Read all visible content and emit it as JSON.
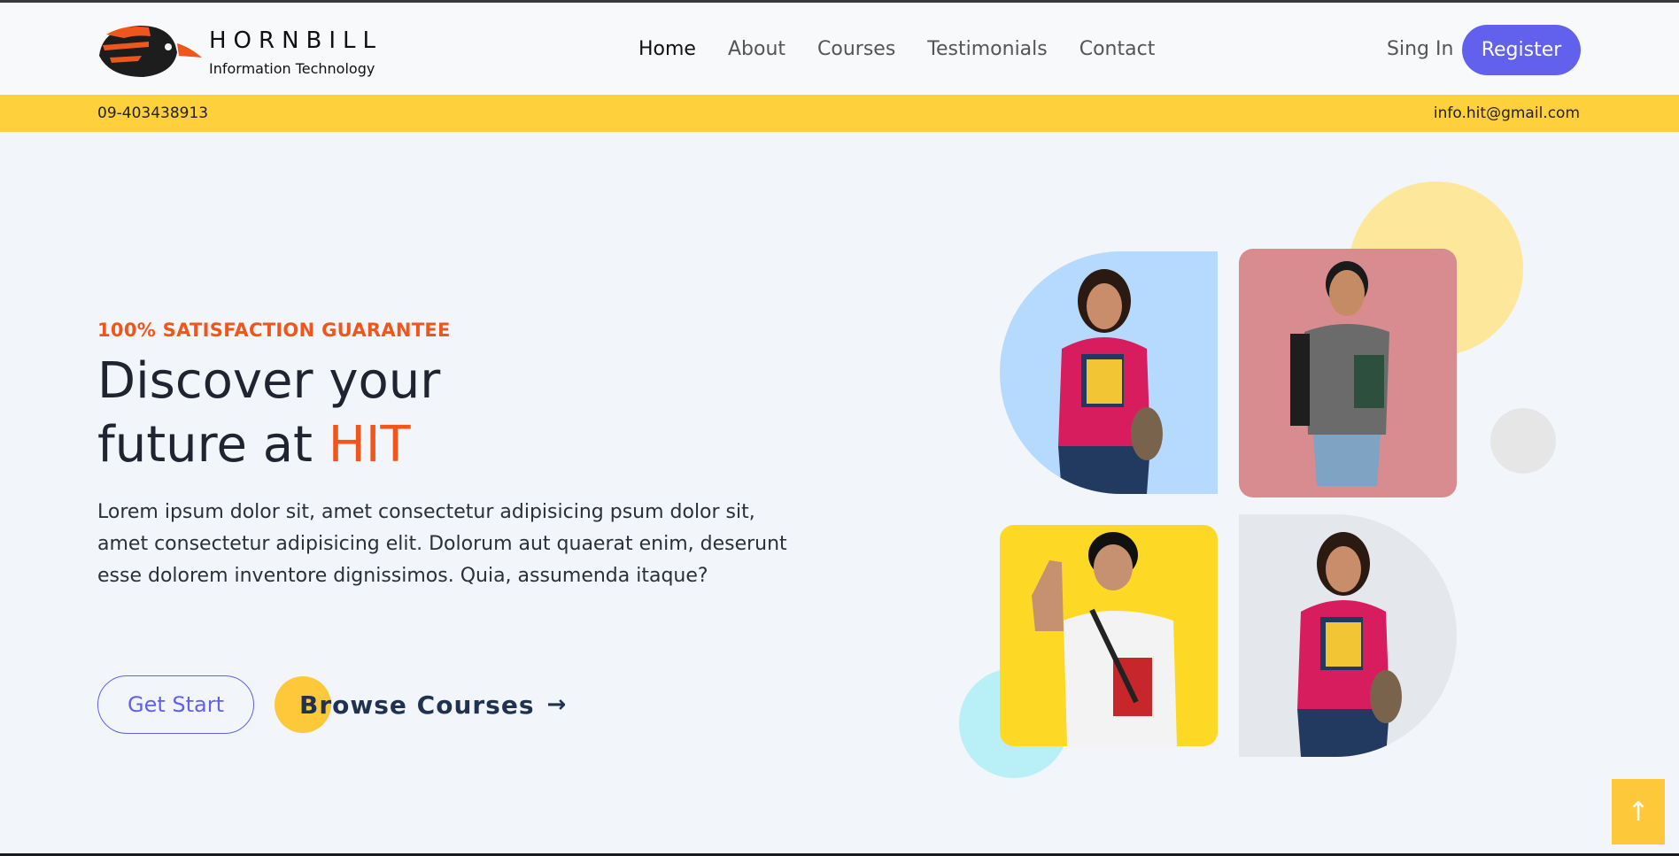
{
  "brand": {
    "name": "HORNBILL",
    "subtitle": "Information Technology"
  },
  "nav": {
    "items": [
      {
        "label": "Home",
        "active": true
      },
      {
        "label": "About"
      },
      {
        "label": "Courses"
      },
      {
        "label": "Testimonials"
      },
      {
        "label": "Contact"
      }
    ],
    "signin_label": "Sing In",
    "register_label": "Register"
  },
  "topbar": {
    "phone": "09-403438913",
    "email": "info.hit@gmail.com"
  },
  "hero": {
    "eyebrow": "100% SATISFACTION GUARANTEE",
    "headline_line1": "Discover your",
    "headline_line2_prefix": "future at ",
    "headline_accent": "HIT",
    "lead": "Lorem ipsum dolor sit, amet consectetur adipisicing psum dolor sit, amet consectetur adipisicing elit. Dolorum aut quaerat enim, deserunt esse dolorem inventore dignissimos. Quia, assumenda itaque?",
    "primary_button": "Get Start",
    "secondary_button": "Browse Courses",
    "secondary_arrow": "→"
  },
  "colors": {
    "accent_orange": "#f0561b",
    "primary_purple": "#6161ee",
    "topbar_yellow": "#fed03b",
    "button_yellow": "#fdc93a"
  },
  "scroll_top_icon": "↑"
}
